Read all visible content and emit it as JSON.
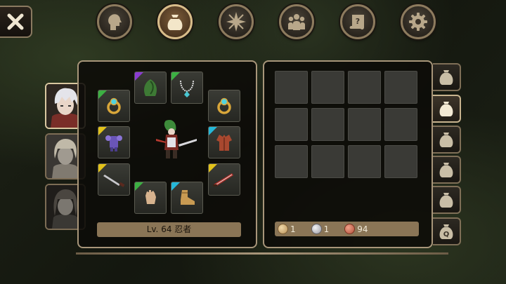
{
  "header": {
    "close": {
      "icon": "close-icon"
    },
    "menu": [
      {
        "name": "character",
        "icon": "head-icon",
        "active": false
      },
      {
        "name": "inventory",
        "icon": "bag-icon",
        "active": true
      },
      {
        "name": "skills",
        "icon": "compass-star-icon",
        "active": false
      },
      {
        "name": "party",
        "icon": "group-icon",
        "active": false
      },
      {
        "name": "quest",
        "icon": "scroll-icon",
        "active": false
      },
      {
        "name": "settings",
        "icon": "gear-icon",
        "active": false
      }
    ]
  },
  "characters": [
    {
      "name": "white-haired-ninja",
      "active": true
    },
    {
      "name": "blonde-girl",
      "active": false
    },
    {
      "name": "dark-haired-girl",
      "active": false
    }
  ],
  "equipment": {
    "level_label": "Lv. 64 忍者",
    "slots": [
      {
        "slot": "head",
        "icon": "green-hood-icon",
        "rarity": "#8a3bd1"
      },
      {
        "slot": "neck",
        "icon": "necklace-icon",
        "rarity": "#3cb043"
      },
      {
        "slot": "ring-left",
        "icon": "gold-ring-icon",
        "rarity": "#3cb043"
      },
      {
        "slot": "ring-right",
        "icon": "gold-ring-icon",
        "rarity": null
      },
      {
        "slot": "armor-left",
        "icon": "purple-armor-icon",
        "rarity": "#e2c21a"
      },
      {
        "slot": "armor-right",
        "icon": "red-vest-icon",
        "rarity": "#25b8d9"
      },
      {
        "slot": "weapon-left",
        "icon": "dagger-icon",
        "rarity": "#e2c21a"
      },
      {
        "slot": "weapon-right",
        "icon": "red-blade-icon",
        "rarity": "#e2c21a"
      },
      {
        "slot": "hands",
        "icon": "gloves-icon",
        "rarity": "#3cb043"
      },
      {
        "slot": "feet",
        "icon": "boots-icon",
        "rarity": "#25b8d9"
      }
    ]
  },
  "bag": {
    "rows": 3,
    "cols": 4,
    "currency": [
      {
        "name": "gold",
        "value": "1",
        "color": "#c9a66b"
      },
      {
        "name": "silver",
        "value": "1",
        "color": "#b8b8c0"
      },
      {
        "name": "copper",
        "value": "94",
        "color": "#c0664a"
      }
    ]
  },
  "bag_tabs": [
    {
      "name": "bag-1",
      "active": false
    },
    {
      "name": "bag-2",
      "active": true
    },
    {
      "name": "bag-3",
      "active": false
    },
    {
      "name": "bag-4",
      "active": false
    },
    {
      "name": "bag-5",
      "active": false
    },
    {
      "name": "quest-bag",
      "label": "Q",
      "active": false
    }
  ]
}
